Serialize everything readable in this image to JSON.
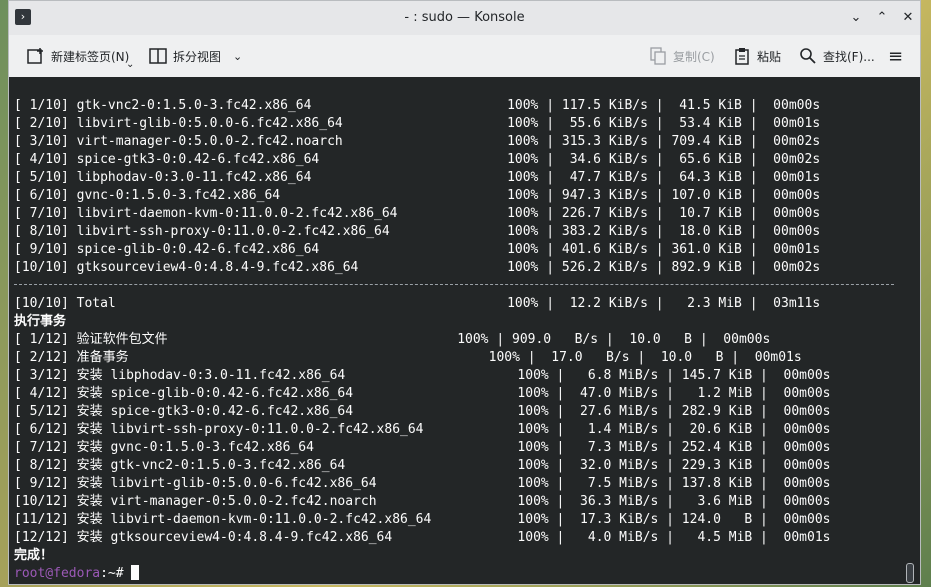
{
  "window": {
    "title": "- : sudo — Konsole",
    "controls": {
      "minimize": "⌄",
      "maximize": "⌃",
      "close": "✕"
    }
  },
  "toolbar": {
    "new_tab": "新建标签页(N)",
    "split_view": "拆分视图",
    "copy": "复制(C)",
    "paste": "粘贴",
    "find": "查找(F)...",
    "menu": "≡"
  },
  "terminal": {
    "download_lines": [
      "[ 1/10] gtk-vnc2-0:1.5.0-3.fc42.x86_64                         100% | 117.5 KiB/s |  41.5 KiB |  00m00s",
      "[ 2/10] libvirt-glib-0:5.0.0-6.fc42.x86_64                     100% |  55.6 KiB/s |  53.4 KiB |  00m01s",
      "[ 3/10] virt-manager-0:5.0.0-2.fc42.noarch                     100% | 315.3 KiB/s | 709.4 KiB |  00m02s",
      "[ 4/10] spice-gtk3-0:0.42-6.fc42.x86_64                        100% |  34.6 KiB/s |  65.6 KiB |  00m02s",
      "[ 5/10] libphodav-0:3.0-11.fc42.x86_64                         100% |  47.7 KiB/s |  64.3 KiB |  00m01s",
      "[ 6/10] gvnc-0:1.5.0-3.fc42.x86_64                             100% | 947.3 KiB/s | 107.0 KiB |  00m00s",
      "[ 7/10] libvirt-daemon-kvm-0:11.0.0-2.fc42.x86_64              100% | 226.7 KiB/s |  10.7 KiB |  00m00s",
      "[ 8/10] libvirt-ssh-proxy-0:11.0.0-2.fc42.x86_64               100% | 383.2 KiB/s |  18.0 KiB |  00m00s",
      "[ 9/10] spice-glib-0:0.42-6.fc42.x86_64                        100% | 401.6 KiB/s | 361.0 KiB |  00m01s",
      "[10/10] gtksourceview4-0:4.8.4-9.fc42.x86_64                   100% | 526.2 KiB/s | 892.9 KiB |  00m02s"
    ],
    "total_line": "[10/10] Total                                                  100% |  12.2 KiB/s |   2.3 MiB |  03m11s",
    "exec_header": "执行事务",
    "tx_lines": [
      "[ 1/12] 验证软件包文件                                     100% | 909.0   B/s |  10.0   B |  00m00s",
      "[ 2/12] 准备事务                                              100% |  17.0   B/s |  10.0   B |  00m01s",
      "[ 3/12] 安装 libphodav-0:3.0-11.fc42.x86_64                      100% |   6.8 MiB/s | 145.7 KiB |  00m00s",
      "[ 4/12] 安装 spice-glib-0:0.42-6.fc42.x86_64                     100% |  47.0 MiB/s |   1.2 MiB |  00m00s",
      "[ 5/12] 安装 spice-gtk3-0:0.42-6.fc42.x86_64                     100% |  27.6 MiB/s | 282.9 KiB |  00m00s",
      "[ 6/12] 安装 libvirt-ssh-proxy-0:11.0.0-2.fc42.x86_64            100% |   1.4 MiB/s |  20.6 KiB |  00m00s",
      "[ 7/12] 安装 gvnc-0:1.5.0-3.fc42.x86_64                          100% |   7.3 MiB/s | 252.4 KiB |  00m00s",
      "[ 8/12] 安装 gtk-vnc2-0:1.5.0-3.fc42.x86_64                      100% |  32.0 MiB/s | 229.3 KiB |  00m00s",
      "[ 9/12] 安装 libvirt-glib-0:5.0.0-6.fc42.x86_64                  100% |   7.5 MiB/s | 137.8 KiB |  00m00s",
      "[10/12] 安装 virt-manager-0:5.0.0-2.fc42.noarch                  100% |  36.3 MiB/s |   3.6 MiB |  00m00s",
      "[11/12] 安装 libvirt-daemon-kvm-0:11.0.0-2.fc42.x86_64           100% |  17.3 KiB/s | 124.0   B |  00m00s",
      "[12/12] 安装 gtksourceview4-0:4.8.4-9.fc42.x86_64                100% |   4.0 MiB/s |   4.5 MiB |  00m01s"
    ],
    "done": "完成！",
    "prompt_user": "root@fedora",
    "prompt_path": ":~# "
  }
}
